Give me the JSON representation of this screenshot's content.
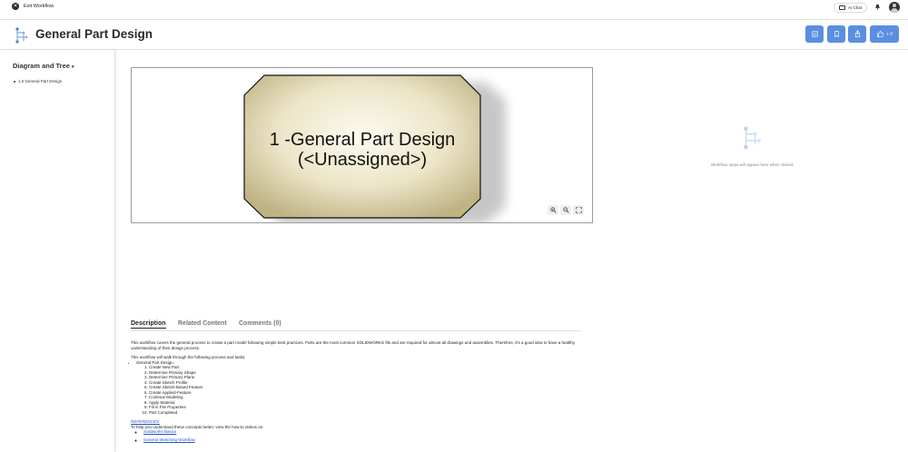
{
  "topbar": {
    "exit_label": "Exit Workflow",
    "ai_chat_label": "AI Chat"
  },
  "header": {
    "title": "General Part Design",
    "plus_label": "+ 0"
  },
  "sidebar": {
    "title": "Diagram and Tree",
    "items": [
      {
        "label": "1.0 General Part Design"
      }
    ]
  },
  "diagram": {
    "node_line1": "1 -General Part Design",
    "node_line2": "(<Unassigned>)"
  },
  "empty_state": {
    "text": "Workflow steps will appear here when clicked"
  },
  "tabs": [
    {
      "label": "Description"
    },
    {
      "label": "Related Content"
    },
    {
      "label": "Comments (0)"
    }
  ],
  "description": {
    "intro": "This workflow covers the general process to create a part model following simple best practices. Parts are the most common SOLIDWORKS file and are required for almost all drawings and assemblies. Therefore, it's a good idea to have a healthy understanding of their design process.",
    "walk_through": "This workflow will walk through the following process and tasks:",
    "process_name": "General Part Design",
    "steps": [
      "Create New Part",
      "Determine Primary Shape",
      "Determine Primary Plane",
      "Create Sketch Profile",
      "Create Sketch-Based Feature",
      "Create Applied-Feature",
      "Continue Modeling",
      "Apply Material",
      "Fill in File Properties",
      "Part Completed"
    ],
    "references_label": "REFERENCES:",
    "references_intro": "To help you understand these concepts better, view the how-to videos on:",
    "links": [
      "Solidworks Basics",
      "General Sketching Workflow"
    ]
  },
  "colors": {
    "accent": "#5a8ee0",
    "node_fill_center": "#fbf8ea",
    "node_fill_edge": "#c9bd90"
  },
  "icons": [
    "close-circle-icon",
    "chat-icon",
    "bell-icon",
    "workflow-logo-icon",
    "document-icon",
    "bookmark-icon",
    "share-icon",
    "thumbs-up-icon",
    "zoom-in-icon",
    "zoom-out-icon",
    "fullscreen-icon"
  ]
}
